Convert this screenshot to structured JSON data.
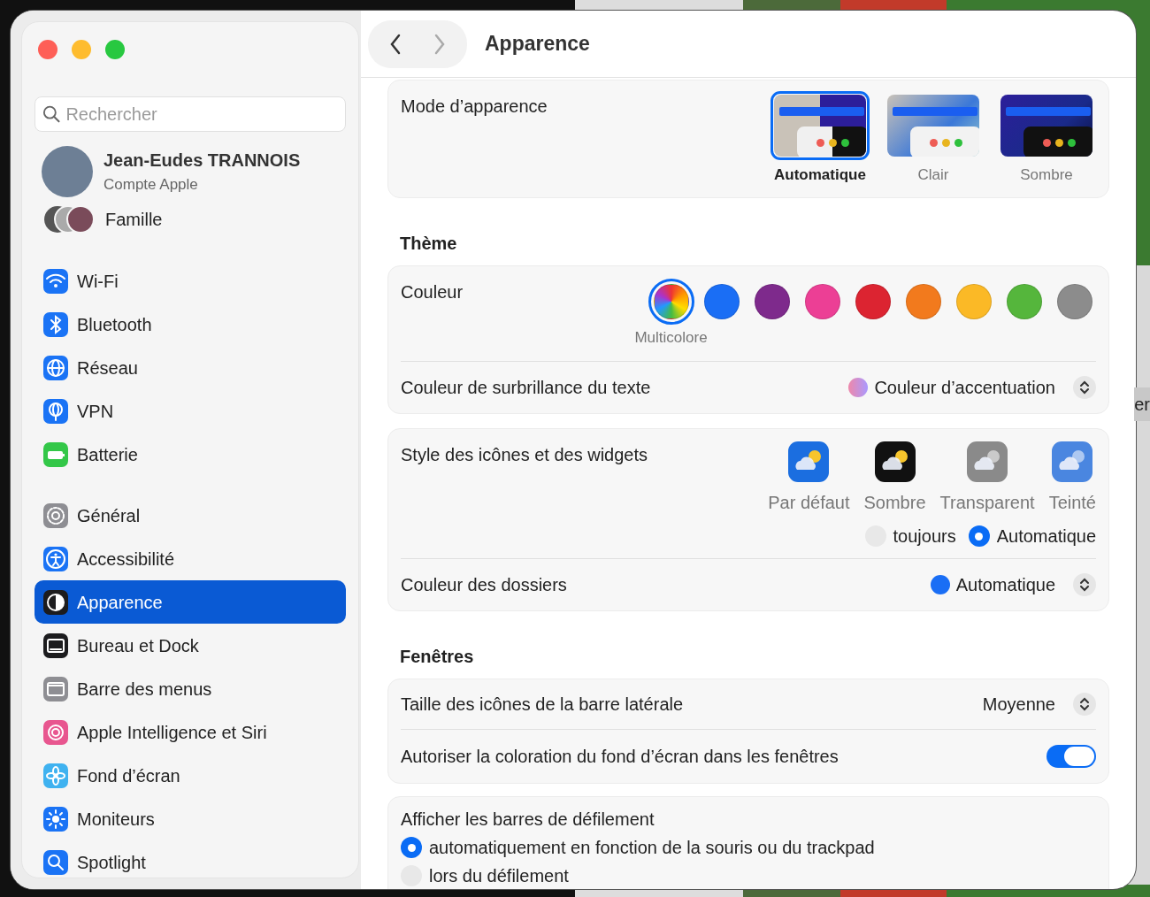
{
  "window": {
    "title": "Apparence"
  },
  "sidebar": {
    "search": {
      "placeholder": "Rechercher"
    },
    "account": {
      "name": "Jean-Eudes TRANNOIS",
      "subtitle": "Compte Apple"
    },
    "family": {
      "label": "Famille"
    },
    "groups": [
      [
        {
          "label": "Wi-Fi",
          "color": "#1a73f5",
          "selected": false
        },
        {
          "label": "Bluetooth",
          "color": "#1a73f5",
          "selected": false
        },
        {
          "label": "Réseau",
          "color": "#1a73f5",
          "selected": false
        },
        {
          "label": "VPN",
          "color": "#1a73f5",
          "selected": false
        },
        {
          "label": "Batterie",
          "color": "#33c748",
          "selected": false
        }
      ],
      [
        {
          "label": "Général",
          "color": "#8e8e93",
          "selected": false
        },
        {
          "label": "Accessibilité",
          "color": "#1a73f5",
          "selected": false
        },
        {
          "label": "Apparence",
          "color": "#1c1c1e",
          "selected": true
        },
        {
          "label": "Bureau et Dock",
          "color": "#1c1c1e",
          "selected": false
        },
        {
          "label": "Barre des menus",
          "color": "#8e8e93",
          "selected": false
        },
        {
          "label": "Apple Intelligence et Siri",
          "color": "#e8568f",
          "selected": false
        },
        {
          "label": "Fond d’écran",
          "color": "#3fb2f0",
          "selected": false
        },
        {
          "label": "Moniteurs",
          "color": "#1a73f5",
          "selected": false
        },
        {
          "label": "Spotlight",
          "color": "#1a73f5",
          "selected": false
        }
      ]
    ]
  },
  "appearance_mode": {
    "label": "Mode d’apparence",
    "options": [
      {
        "label": "Automatique",
        "kind": "auto",
        "selected": true
      },
      {
        "label": "Clair",
        "kind": "light",
        "selected": false
      },
      {
        "label": "Sombre",
        "kind": "dark",
        "selected": false
      }
    ]
  },
  "theme": {
    "heading": "Thème",
    "accent": {
      "label": "Couleur",
      "selected_name": "Multicolore",
      "colors": [
        {
          "kind": "multicolor",
          "selected": true
        },
        {
          "kind": "solid",
          "color": "#1a6ef5",
          "selected": false
        },
        {
          "kind": "solid",
          "color": "#7e2a8c",
          "selected": false
        },
        {
          "kind": "solid",
          "color": "#ec3f95",
          "selected": false
        },
        {
          "kind": "solid",
          "color": "#dc2431",
          "selected": false
        },
        {
          "kind": "solid",
          "color": "#f27a1d",
          "selected": false
        },
        {
          "kind": "solid",
          "color": "#fbb926",
          "selected": false
        },
        {
          "kind": "solid",
          "color": "#55b63c",
          "selected": false
        },
        {
          "kind": "solid",
          "color": "#8c8c8c",
          "selected": false
        }
      ]
    },
    "highlight": {
      "label": "Couleur de surbrillance du texte",
      "value": "Couleur d’accentuation"
    }
  },
  "widgets": {
    "label": "Style des icônes et des widgets",
    "styles": [
      {
        "label": "Par défaut",
        "kind": "default"
      },
      {
        "label": "Sombre",
        "kind": "dark"
      },
      {
        "label": "Transparent",
        "kind": "clear"
      },
      {
        "label": "Teinté",
        "kind": "tinted"
      }
    ],
    "options": [
      {
        "label": "toujours",
        "selected": false
      },
      {
        "label": "Automatique",
        "selected": true
      }
    ],
    "folder_color": {
      "label": "Couleur des dossiers",
      "value": "Automatique",
      "color": "#1a6ef5"
    }
  },
  "windows": {
    "heading": "Fenêtres",
    "sidebar_icon_size": {
      "label": "Taille des icônes de la barre latérale",
      "value": "Moyenne"
    },
    "wallpaper_tinting": {
      "label": "Autoriser la coloration du fond d’écran dans les fenêtres",
      "on": true
    }
  },
  "scroll_bars": {
    "label": "Afficher les barres de défilement",
    "options": [
      {
        "label": "automatiquement en fonction de la souris ou du trackpad",
        "selected": true
      },
      {
        "label": "lors du défilement",
        "selected": false
      }
    ]
  },
  "background_window": {
    "text": "er"
  }
}
